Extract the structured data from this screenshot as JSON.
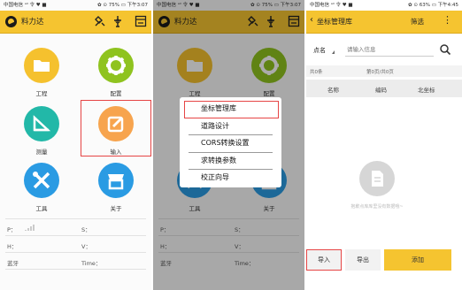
{
  "status_left": "中国电信 ᵃˡˡ 令 ♥ ■",
  "status_right_p1": "✿ ⊙ 75% ▭ 下午3:07",
  "status_right_p3": "✿ ⊙ 63% ▭ 下午4:45",
  "app_title": "料力达",
  "home_items": [
    {
      "label": "工程",
      "icon": "folder-icon",
      "color": "#f5c12e"
    },
    {
      "label": "配置",
      "icon": "gear-icon",
      "color": "#8fc31f"
    },
    {
      "label": "测量",
      "icon": "ruler-icon",
      "color": "#22b8a8"
    },
    {
      "label": "输入",
      "icon": "edit-icon",
      "color": "#f7a44e"
    },
    {
      "label": "工具",
      "icon": "tools-icon",
      "color": "#2a9be3"
    },
    {
      "label": "关于",
      "icon": "shop-icon",
      "color": "#2a9be3"
    }
  ],
  "info": {
    "p": "P：",
    "s": "S：",
    "h": "H：",
    "v": "V：",
    "bluetooth": "蓝牙",
    "time": "Time："
  },
  "menu_items": [
    "坐标管理库",
    "道路设计",
    "CORS转换设置",
    "求转换参数",
    "校正向导"
  ],
  "p3": {
    "title": "坐标管理库",
    "filter": "筛选",
    "more": "⋮",
    "field": "点名",
    "placeholder": "请输入信息",
    "count": "共0条",
    "page": "第0页/共0页",
    "col_name": "名称",
    "col_code": "编码",
    "col_north": "北坐标",
    "empty_text": "抱歉点库库里没有数据哦~",
    "btn_import": "导入",
    "btn_export": "导出",
    "btn_add": "添加"
  },
  "colors": {
    "accent": "#f5c430",
    "highlight": "#e64545"
  }
}
